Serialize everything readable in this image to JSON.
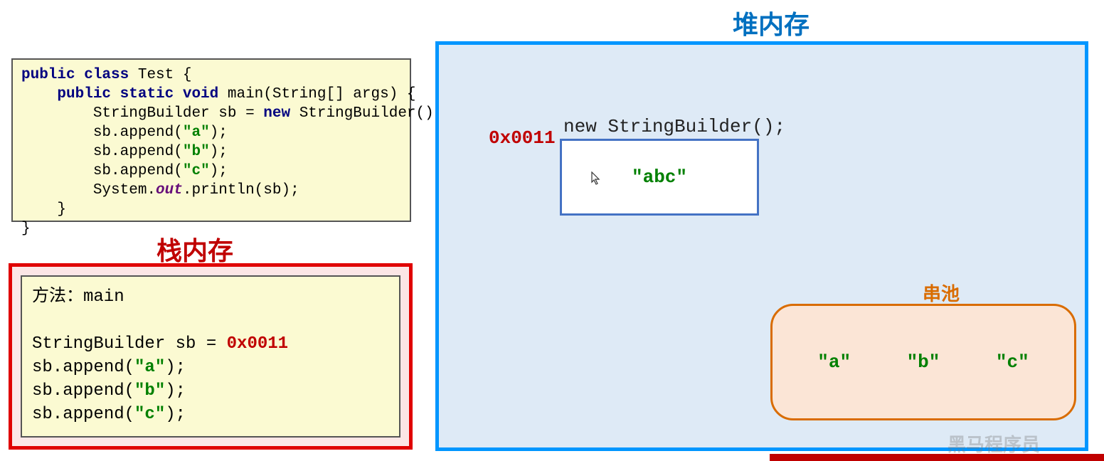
{
  "heap": {
    "title": "堆内存",
    "address": "0x0011",
    "sb_label": "new StringBuilder();",
    "sb_content": "\"abc\"",
    "pool_title": "串池",
    "pool_items": [
      "\"a\"",
      "\"b\"",
      "\"c\""
    ]
  },
  "code": {
    "line1_kw1": "public class",
    "line1_rest": " Test {",
    "line2_kw1": "public static void",
    "line2_rest": " main(String[] args) {",
    "line3_a": "StringBuilder sb = ",
    "line3_kw": "new",
    "line3_b": " StringBuilder();",
    "line4_a": "sb.append(",
    "line4_s": "\"a\"",
    "line4_b": ");",
    "line5_a": "sb.append(",
    "line5_s": "\"b\"",
    "line5_b": ");",
    "line6_a": "sb.append(",
    "line6_s": "\"c\"",
    "line6_b": ");",
    "line7_a": "System.",
    "line7_it": "out",
    "line7_b": ".println(sb);",
    "line8": "    }",
    "line9": "}"
  },
  "stack": {
    "title": "栈内存",
    "method_label": "方法：",
    "method_name": "main",
    "var_decl": "StringBuilder sb = ",
    "var_addr": "0x0011",
    "l1a": "sb.append(",
    "l1s": "\"a\"",
    "l1b": ");",
    "l2a": "sb.append(",
    "l2s": "\"b\"",
    "l2b": ");",
    "l3a": "sb.append(",
    "l3s": "\"c\"",
    "l3b": ");"
  },
  "watermark": "黑马程序员"
}
